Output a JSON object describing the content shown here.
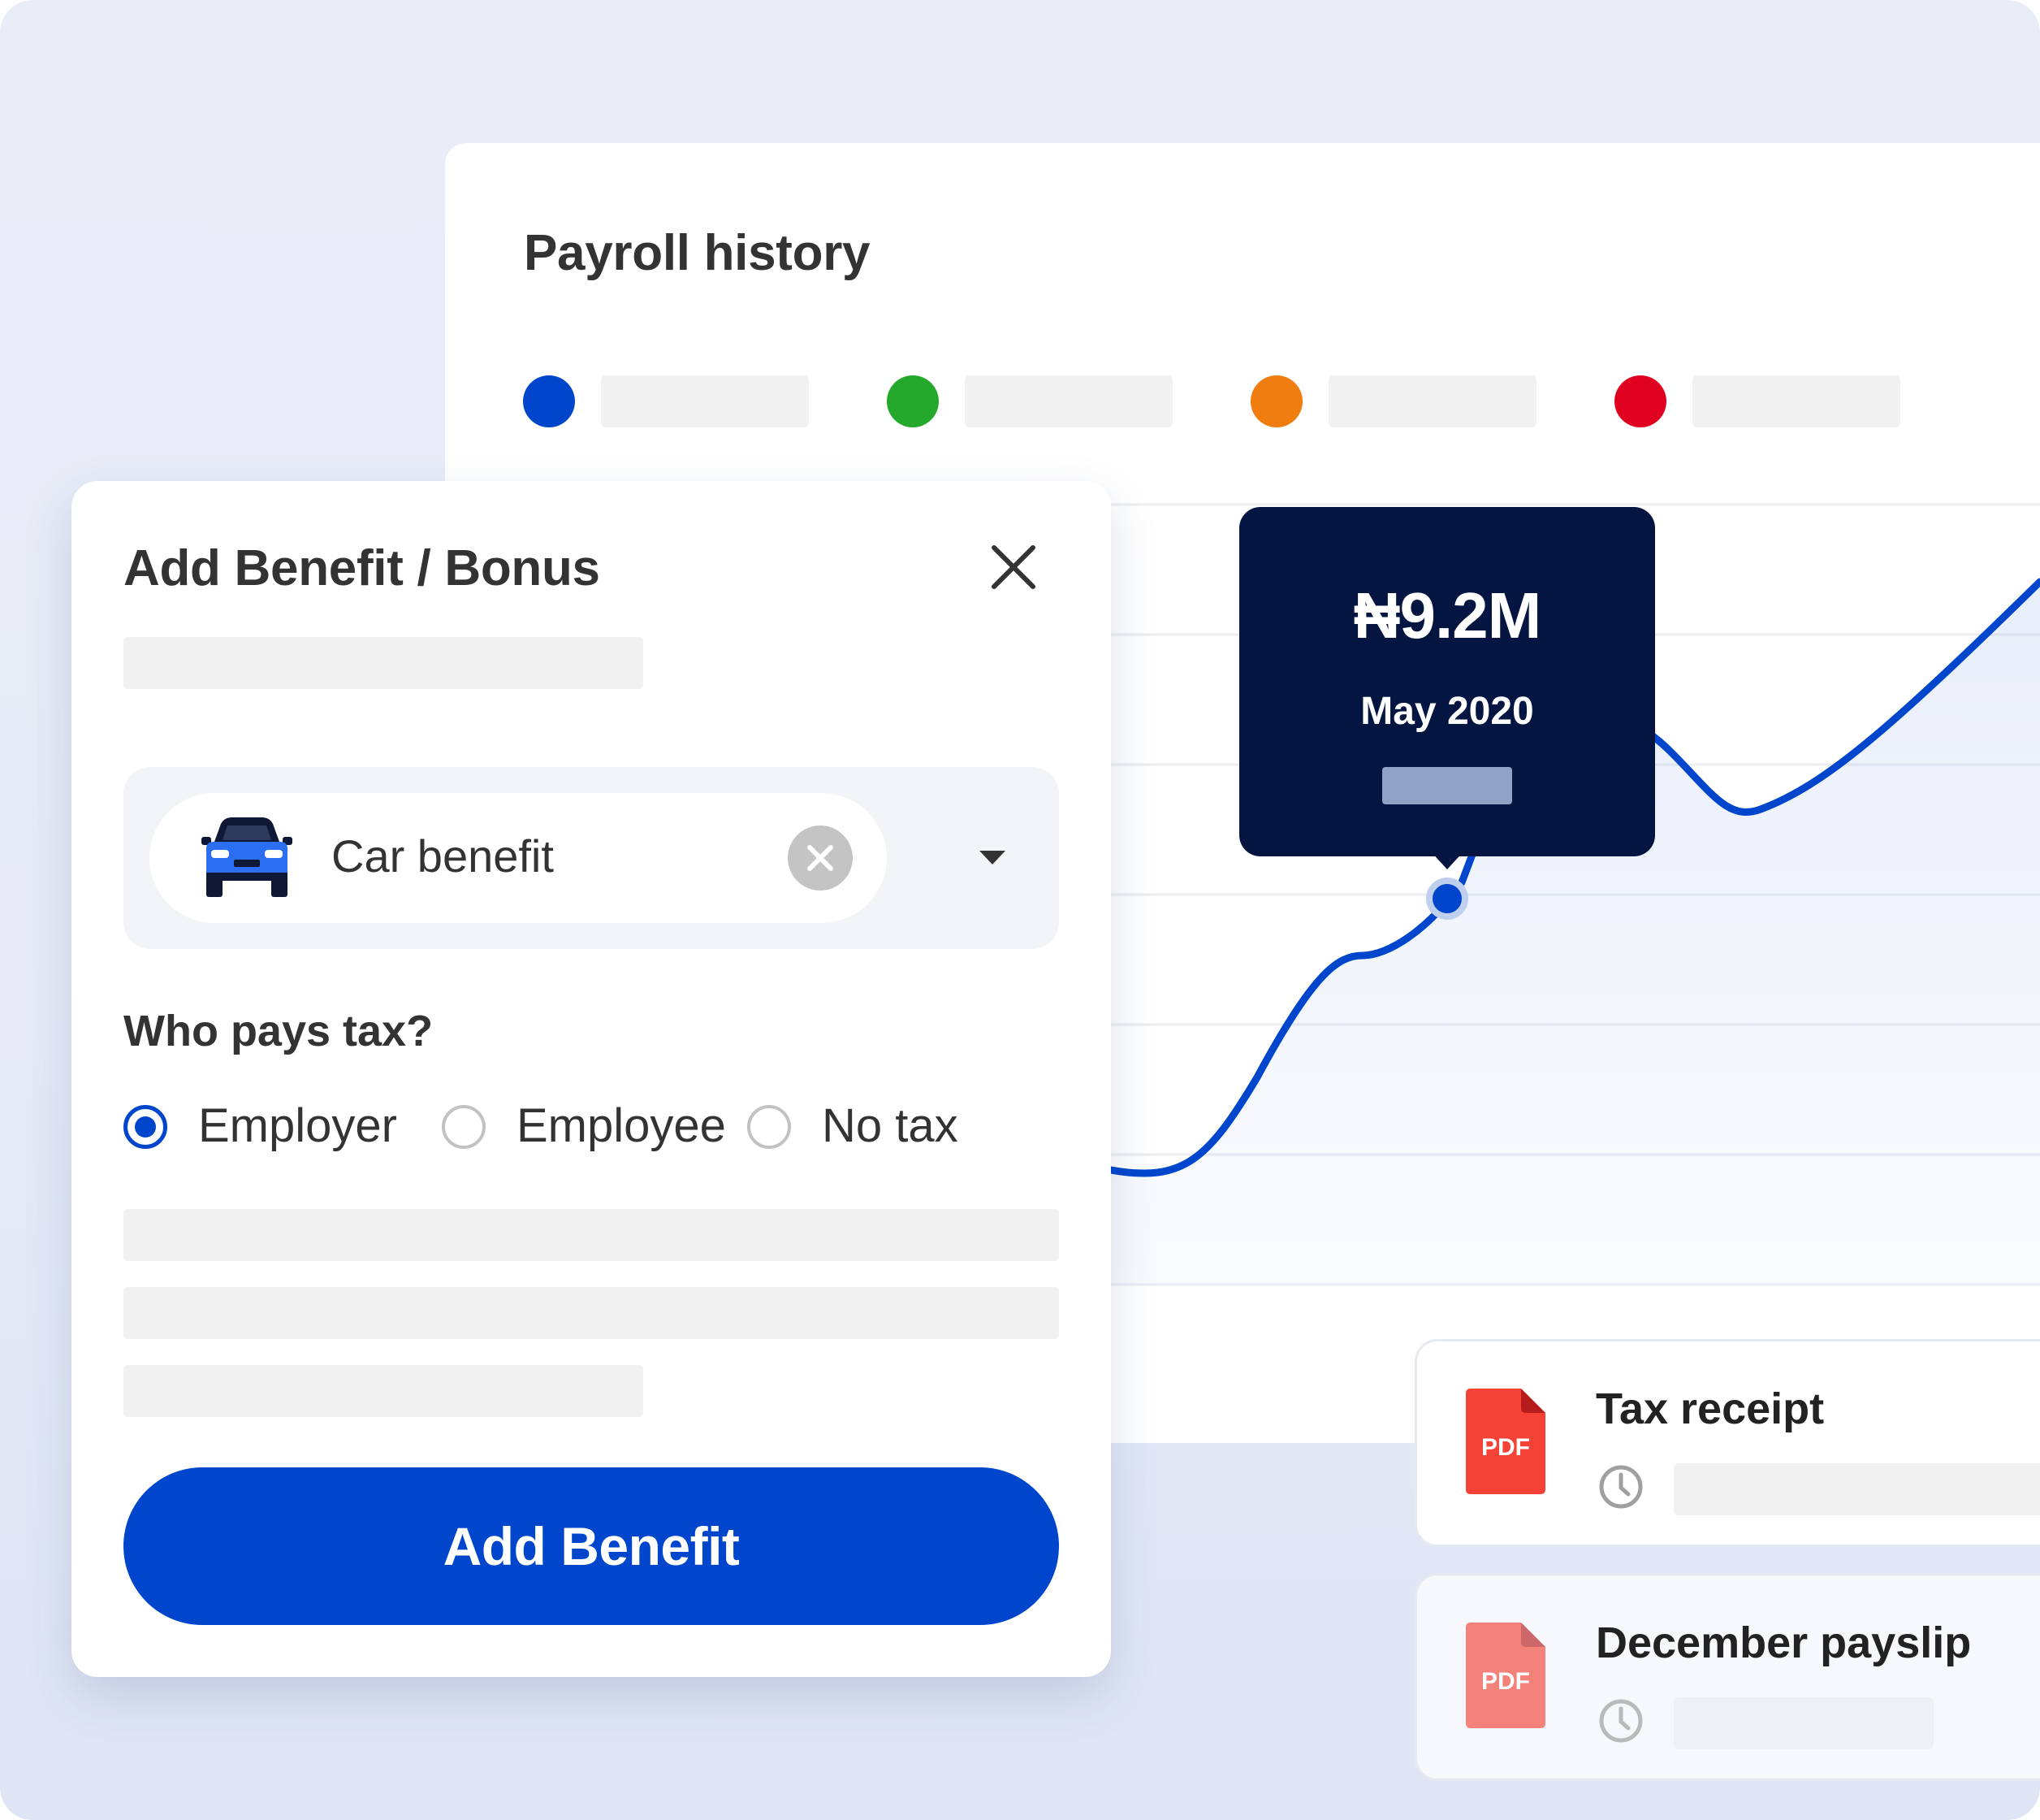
{
  "payroll_history": {
    "title": "Payroll history",
    "legend_colors": [
      "#0046cc",
      "#25a92c",
      "#f07d0f",
      "#e00020"
    ]
  },
  "tooltip": {
    "value": "₦9.2M",
    "date": "May 2020"
  },
  "colors": {
    "accent": "#0046cc",
    "tooltip_bg": "#031540",
    "pdf_red": "#f44336"
  },
  "modal": {
    "title": "Add Benefit / Bonus",
    "selected_benefit": "Car benefit",
    "tax_question": "Who pays tax?",
    "tax_options": [
      {
        "label": "Employer",
        "checked": true
      },
      {
        "label": "Employee",
        "checked": false
      },
      {
        "label": "No tax",
        "checked": false
      }
    ],
    "submit_label": "Add Benefit"
  },
  "documents": [
    {
      "title": "Tax receipt",
      "icon": "pdf-icon",
      "badge": "PDF"
    },
    {
      "title": "December payslip",
      "icon": "pdf-icon",
      "badge": "PDF"
    }
  ]
}
